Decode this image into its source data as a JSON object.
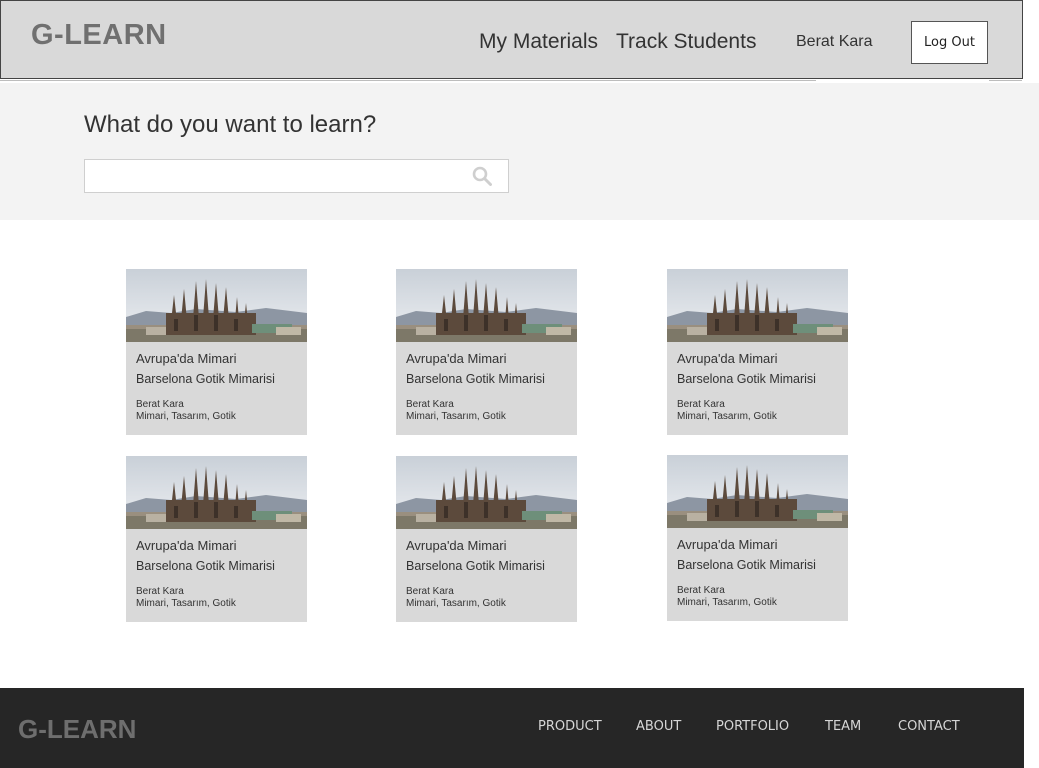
{
  "header": {
    "logo": "G-LEARN",
    "nav": [
      "My Materials",
      "Track Students"
    ],
    "user_name": "Berat Kara",
    "logout_label": "Log Out"
  },
  "search": {
    "title": "What do you want to learn?",
    "value": "",
    "placeholder": "",
    "icon": "search-icon"
  },
  "cards": [
    {
      "title": "Avrupa'da Mimari",
      "subtitle": "Barselona Gotik Mimarisi",
      "author": "Berat Kara",
      "tags": "Mimari, Tasarım, Gotik"
    },
    {
      "title": "Avrupa'da Mimari",
      "subtitle": "Barselona Gotik Mimarisi",
      "author": "Berat Kara",
      "tags": "Mimari, Tasarım, Gotik"
    },
    {
      "title": "Avrupa'da Mimari",
      "subtitle": "Barselona Gotik Mimarisi",
      "author": "Berat Kara",
      "tags": "Mimari, Tasarım, Gotik"
    },
    {
      "title": "Avrupa'da Mimari",
      "subtitle": "Barselona Gotik Mimarisi",
      "author": "Berat Kara",
      "tags": "Mimari, Tasarım, Gotik"
    },
    {
      "title": "Avrupa'da Mimari",
      "subtitle": "Barselona Gotik Mimarisi",
      "author": "Berat Kara",
      "tags": "Mimari, Tasarım, Gotik"
    },
    {
      "title": "Avrupa'da Mimari",
      "subtitle": "Barselona Gotik Mimarisi",
      "author": "Berat Kara",
      "tags": "Mimari, Tasarım, Gotik"
    }
  ],
  "footer": {
    "logo": "G-LEARN",
    "links": [
      "PRODUCT",
      "ABOUT",
      "PORTFOLIO",
      "TEAM",
      "CONTACT"
    ]
  },
  "colors": {
    "header_bg": "#d9d9d9",
    "search_band_bg": "#f3f3f3",
    "card_bg": "#d9d9d9",
    "footer_bg": "#262626"
  }
}
